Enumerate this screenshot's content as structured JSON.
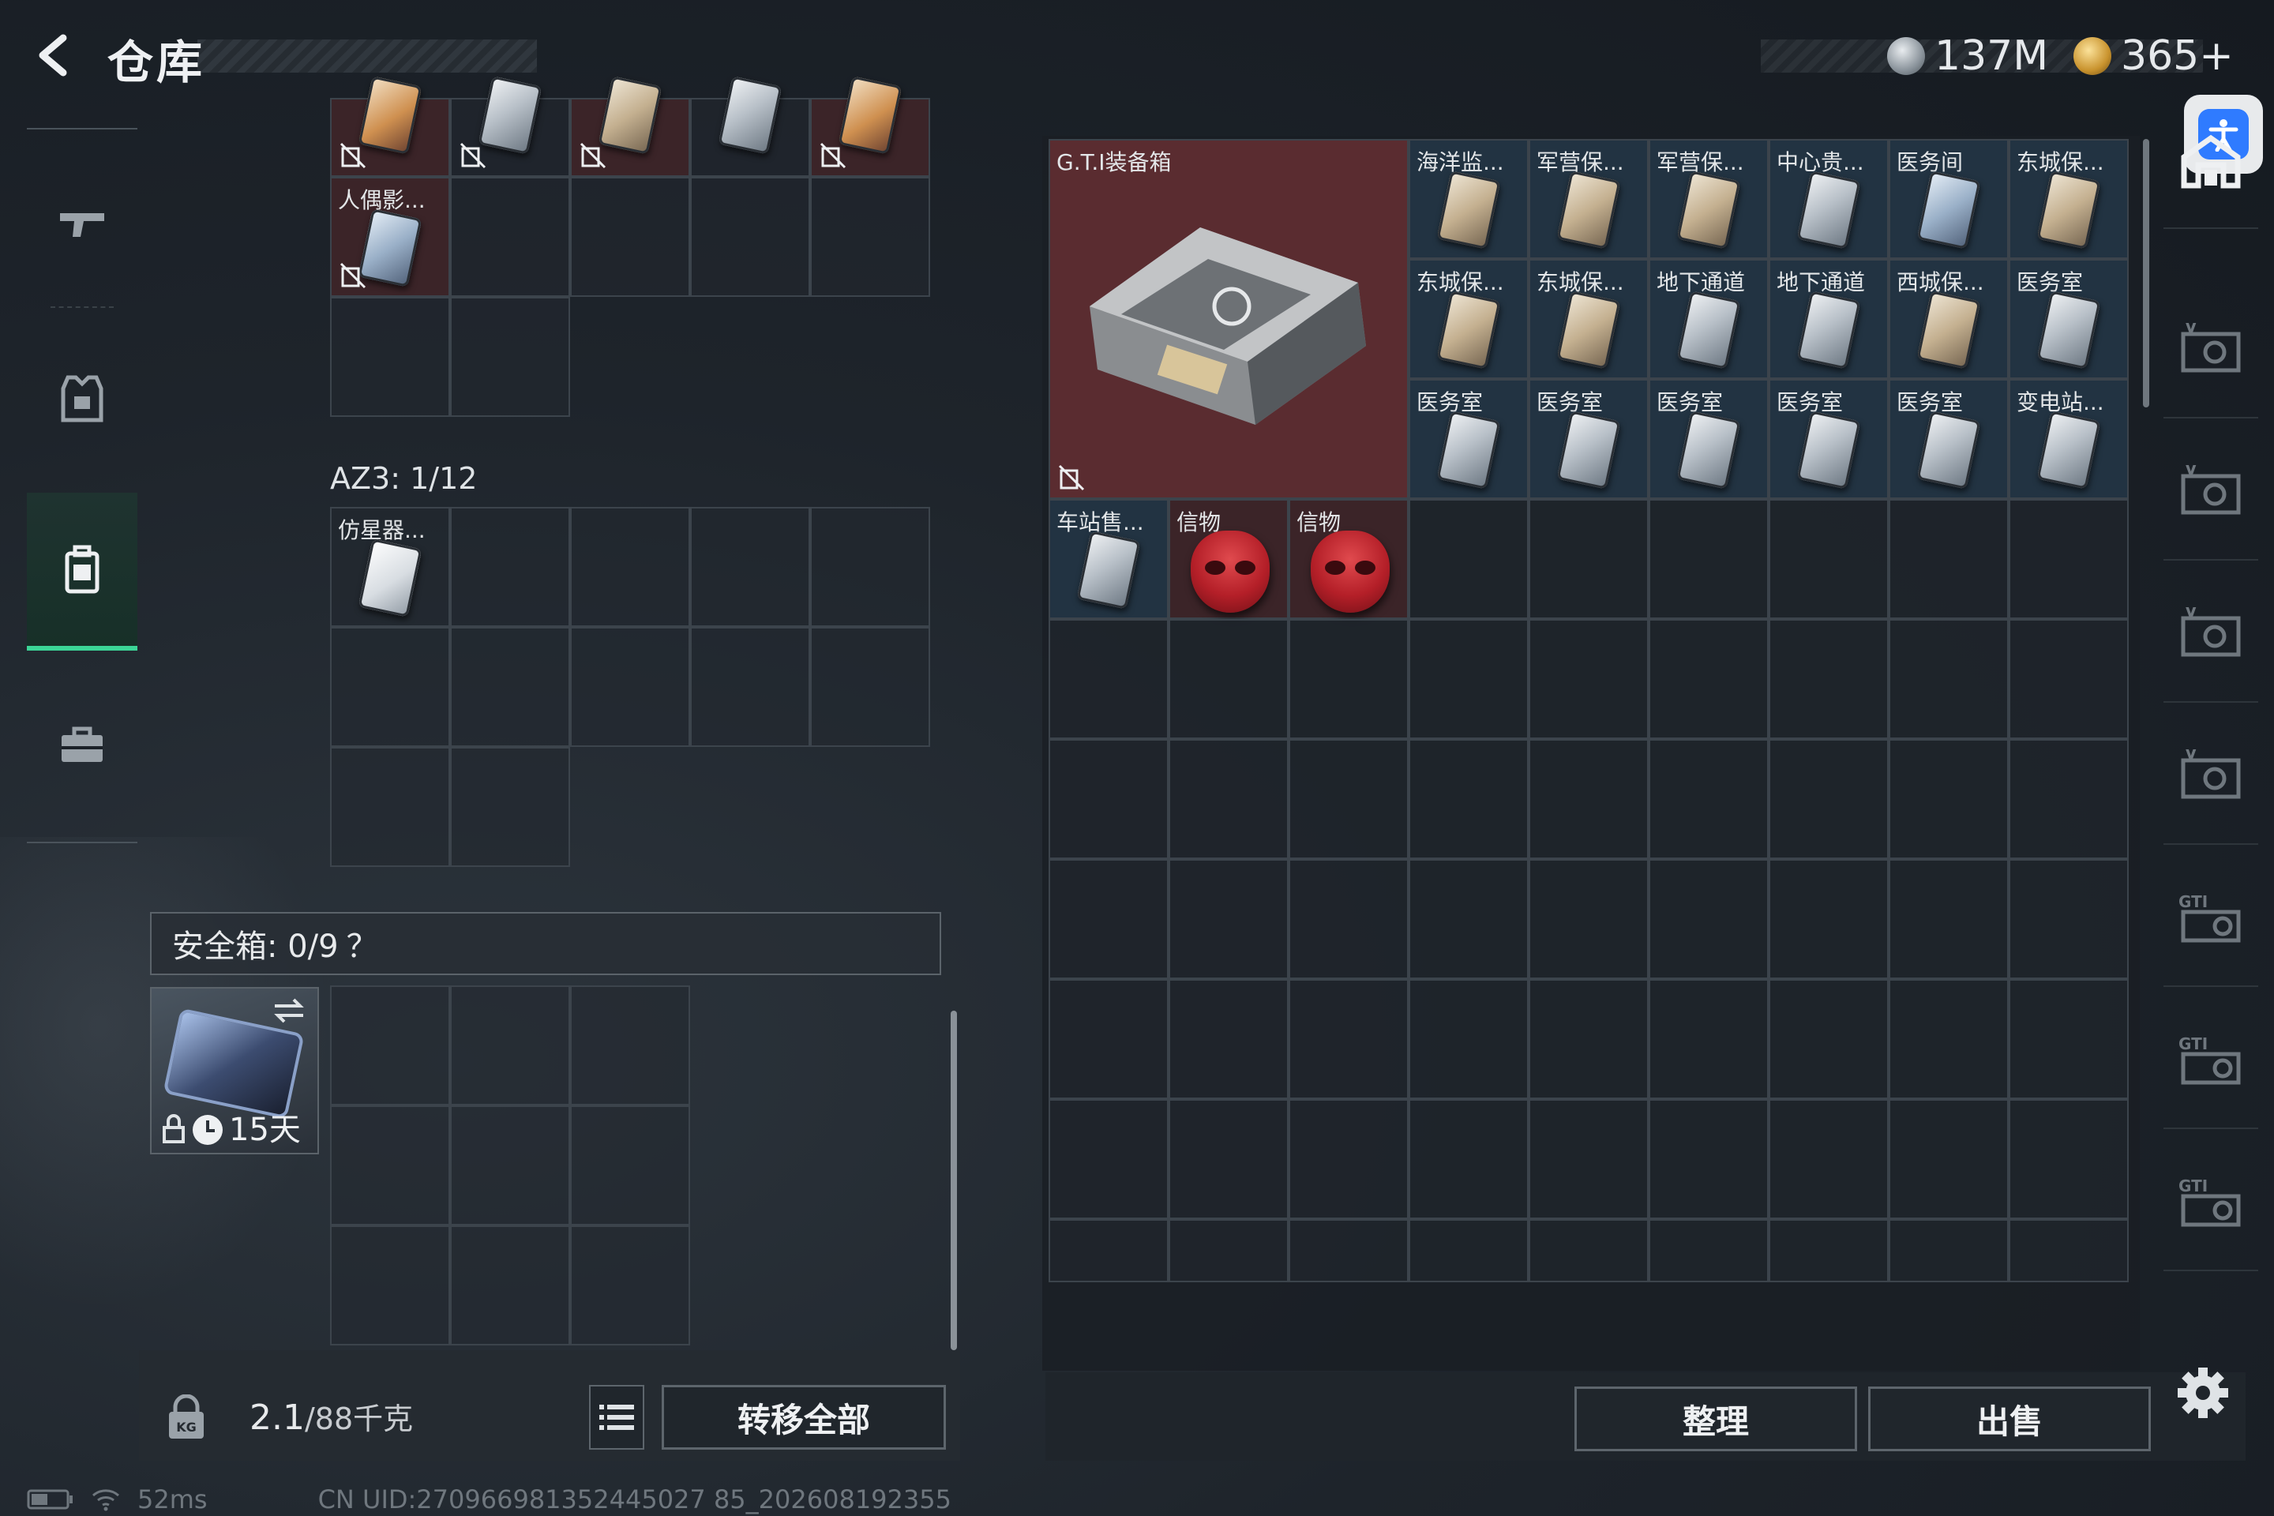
{
  "header": {
    "title": "仓库",
    "currency1": "137M",
    "currency2": "365+"
  },
  "left_nav": [
    {
      "icon": "rifle-icon"
    },
    {
      "icon": "vest-icon"
    },
    {
      "icon": "backpack-icon",
      "selected": true
    },
    {
      "icon": "briefcase-icon"
    }
  ],
  "container1": {
    "items": [
      {
        "label": "",
        "card": "orange",
        "noslot": true
      },
      {
        "label": "",
        "card": "",
        "noslot": true
      },
      {
        "label": "",
        "card": "tan",
        "noslot": true
      },
      {
        "label": "",
        "card": "",
        "noslot": false
      },
      {
        "label": "",
        "card": "orange",
        "noslot": true
      },
      {
        "label": "人偶影...",
        "card": "blu",
        "noslot": true
      }
    ]
  },
  "container2": {
    "title": "AZ3: 1/12",
    "items": [
      {
        "label": "仿星器...",
        "card": "white"
      }
    ]
  },
  "safe_box": {
    "title": "安全箱: 0/9",
    "help": "？",
    "duration": "15天"
  },
  "weight": {
    "current": "2.1",
    "capacity": "/88千克"
  },
  "buttons": {
    "transfer_all": "转移全部",
    "sort": "整理",
    "sell": "出售"
  },
  "stash": {
    "big_item_label": "G.T.I装备箱",
    "grid_items": [
      {
        "label": "海洋监...",
        "card": "tan"
      },
      {
        "label": "军营保...",
        "card": "tan"
      },
      {
        "label": "军营保...",
        "card": "tan"
      },
      {
        "label": "中心贵...",
        "card": ""
      },
      {
        "label": "医务间",
        "card": "blu"
      },
      {
        "label": "东城保...",
        "card": "tan"
      },
      {
        "label": "东城保...",
        "card": "tan"
      },
      {
        "label": "东城保...",
        "card": "tan"
      },
      {
        "label": "地下通道",
        "card": ""
      },
      {
        "label": "地下通道",
        "card": ""
      },
      {
        "label": "西城保...",
        "card": "tan"
      },
      {
        "label": "医务室",
        "card": ""
      },
      {
        "label": "医务室",
        "card": ""
      },
      {
        "label": "医务室",
        "card": ""
      },
      {
        "label": "医务室",
        "card": ""
      },
      {
        "label": "医务室",
        "card": ""
      },
      {
        "label": "医务室",
        "card": ""
      },
      {
        "label": "变电站...",
        "card": ""
      }
    ],
    "row4_items": [
      {
        "label": "车站售...",
        "type": "card"
      },
      {
        "label": "信物",
        "type": "mask"
      },
      {
        "label": "信物",
        "type": "mask"
      }
    ]
  },
  "right_nav": [
    "warehouse-icon",
    "vault-icon-1",
    "vault-icon-2",
    "vault-icon-3",
    "vault-icon-4",
    "gti-vault-icon-1",
    "gti-vault-icon-2",
    "gti-vault-icon-3"
  ],
  "status": {
    "ping": "52ms",
    "uid": "CN UID:270966981352445027 85_202608192355"
  },
  "colors": {
    "accent": "#3cd597",
    "red_item": "#3b2428",
    "blue_item": "#223342"
  }
}
